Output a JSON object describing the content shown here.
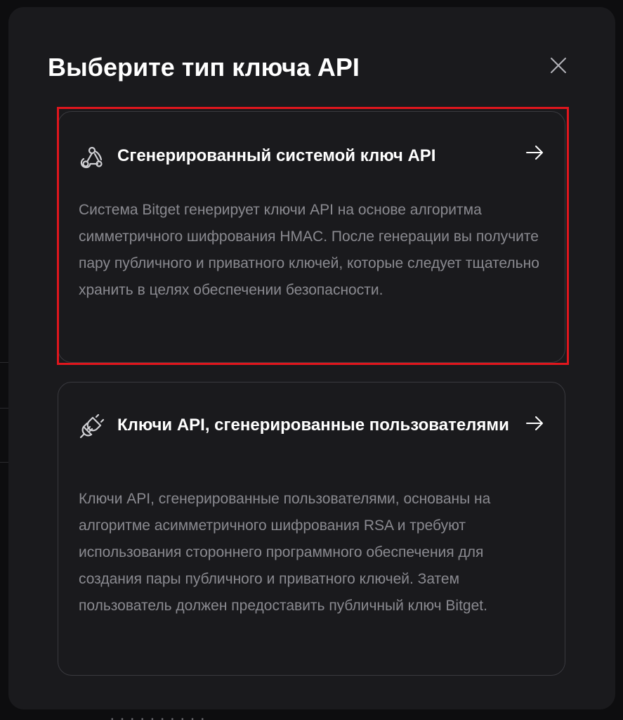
{
  "dialog": {
    "title": "Выберите тип ключа API",
    "close_icon": "close-icon"
  },
  "options": [
    {
      "icon": "webhook-icon",
      "title": "Сгенерированный системой ключ API",
      "description": "Система Bitget генерирует ключи API на основе алгоритма симметричного шифрования HMAC. После генерации вы получите пару публичного и приватного ключей, которые следует тщательно хранить в целях обеспечении безопасности.",
      "arrow_icon": "arrow-right-icon",
      "highlight_color": "#e0161d"
    },
    {
      "icon": "plug-connection-icon",
      "title": "Ключи API, сгенерированные пользователями",
      "description": "Ключи API, сгенерированные пользователями, основаны на алгоритме асимметричного шифрования RSA и требуют использования стороннего программного обеспечения для создания пары публичного и приватного ключей. Затем пользователь должен предоставить публичный ключ Bitget.",
      "arrow_icon": "arrow-right-icon"
    }
  ],
  "colors": {
    "modal_bg": "#1a1a1d",
    "card_border": "#3a3a3f",
    "title": "#ffffff",
    "description": "#8a8a90"
  }
}
